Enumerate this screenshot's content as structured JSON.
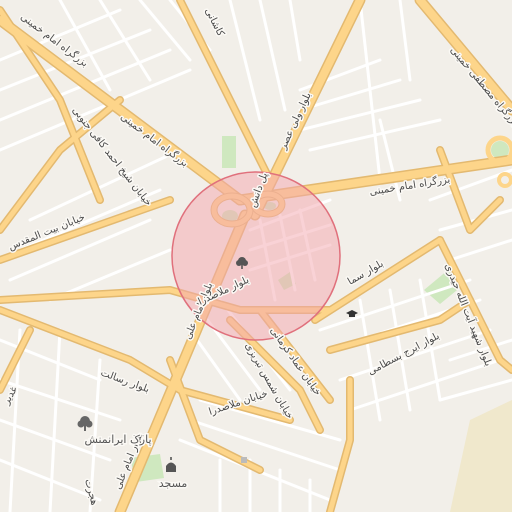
{
  "map": {
    "colors": {
      "background": "#f2efe9",
      "minor_road": "#ffffff",
      "minor_road_casing": "#d9d3c8",
      "major_road": "#fdd58a",
      "major_road_casing": "#e3b970",
      "park": "#cfe8bf",
      "highlight_fill": "#f4a6ae",
      "highlight_stroke": "#e0707c"
    },
    "highlight": {
      "shape": "circle",
      "label": ""
    },
    "street_labels": {
      "imam_khomeini_nw": "بزرگراه امام خمینی",
      "imam_khomeini_e": "بزرگراه امام خمینی",
      "mostafa_khomeini": "بزرگراه مصطفی خمینی",
      "vali_asr": "بلوار ولی عصر",
      "kashani": "کاشانی",
      "daneshgah": "پل دانش",
      "sheikh_ahmad_kafi": "خیابان شیخ احمد کافی جنوبی",
      "beit_ol_moghaddas": "خیابان بیت المقدس",
      "imam_ali": "بلوار امام علی",
      "imam_ali_south": "بلوار امام علی",
      "mollasadra_north": "بلوار ملاصدرا",
      "mollasadra_south": "خیابان ملاصدرا",
      "sama": "بلوار سما",
      "ayatollah_heidari": "بلوار شهید آیت الله حیدری",
      "iraj_bastami": "بلوار ایرج بسطامی",
      "emad_kermani": "خیابان عماد کرمانی",
      "shams_tabrizi": "خیابان شمس تبریزی",
      "resalat": "بلوار رسالت",
      "ghadir": "غدیر",
      "hejrat": "هجرت"
    },
    "pois": {
      "park_name": "پارک ایرانمنش",
      "mosque": "مسجد"
    },
    "icons": {
      "tree": "tree-icon",
      "school": "graduation-cap-icon",
      "mosque": "mosque-icon"
    }
  }
}
